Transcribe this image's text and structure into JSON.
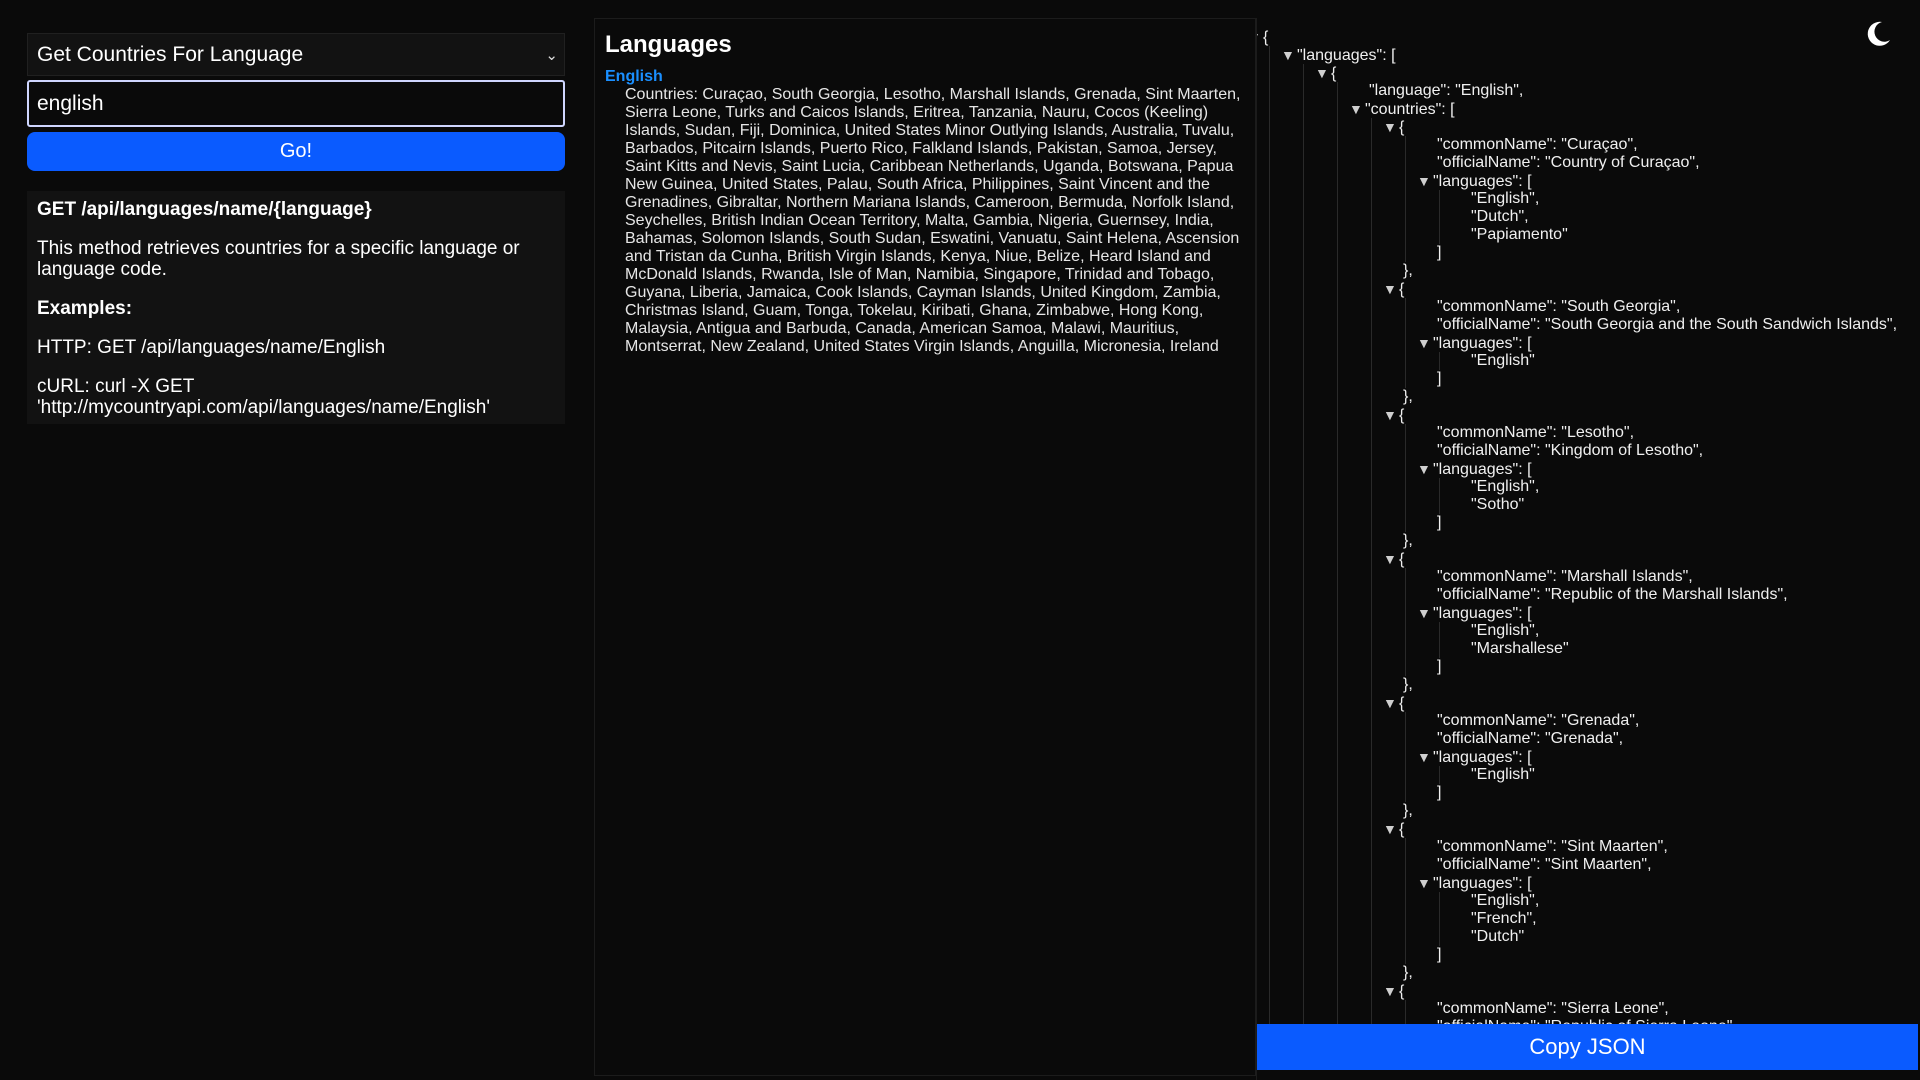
{
  "left": {
    "method_select": "Get Countries For Language",
    "input_value": "english",
    "go_label": "Go!",
    "doc": {
      "endpoint": "GET /api/languages/name/{language}",
      "description": "This method retrieves countries for a specific language or language code.",
      "examples_heading": "Examples:",
      "http_example": "HTTP: GET /api/languages/name/English",
      "curl_example": "cURL: curl -X GET 'http://mycountryapi.com/api/languages/name/English'"
    }
  },
  "middle": {
    "title": "Languages",
    "language": "English",
    "countries": "Countries: Curaçao, South Georgia, Lesotho, Marshall Islands, Grenada, Sint Maarten, Sierra Leone, Turks and Caicos Islands, Eritrea, Tanzania, Nauru, Cocos (Keeling) Islands, Sudan, Fiji, Dominica, United States Minor Outlying Islands, Australia, Tuvalu, Barbados, Pitcairn Islands, Puerto Rico, Falkland Islands, Pakistan, Samoa, Jersey, Saint Kitts and Nevis, Saint Lucia, Caribbean Netherlands, Uganda, Botswana, Papua New Guinea, United States, Palau, South Africa, Philippines, Saint Vincent and the Grenadines, Gibraltar, Northern Mariana Islands, Cameroon, Bermuda, Norfolk Island, Seychelles, British Indian Ocean Territory, Malta, Gambia, Nigeria, Guernsey, India, Bahamas, Solomon Islands, South Sudan, Eswatini, Vanuatu, Saint Helena, Ascension and Tristan da Cunha, British Virgin Islands, Kenya, Niue, Belize, Heard Island and McDonald Islands, Rwanda, Isle of Man, Namibia, Singapore, Trinidad and Tobago, Guyana, Liberia, Jamaica, Cook Islands, Cayman Islands, United Kingdom, Zambia, Christmas Island, Guam, Tonga, Tokelau, Kiribati, Ghana, Zimbabwe, Hong Kong, Malaysia, Antigua and Barbuda, Canada, American Samoa, Malawi, Mauritius, Montserrat, New Zealand, United States Virgin Islands, Anguilla, Micronesia, Ireland"
  },
  "right": {
    "copy_label": "Copy JSON",
    "theme_icon": "moon-icon",
    "json_lines": [
      {
        "indent": 0,
        "tri": true,
        "text": "{"
      },
      {
        "indent": 1,
        "tri": true,
        "text": "\"languages\": ["
      },
      {
        "indent": 2,
        "tri": true,
        "text": "{"
      },
      {
        "indent": 3,
        "tri": false,
        "text": "\"language\": \"English\","
      },
      {
        "indent": 3,
        "tri": true,
        "text": "\"countries\": ["
      },
      {
        "indent": 4,
        "tri": true,
        "text": "{"
      },
      {
        "indent": 5,
        "tri": false,
        "text": "\"commonName\": \"Curaçao\","
      },
      {
        "indent": 5,
        "tri": false,
        "text": "\"officialName\": \"Country of Curaçao\","
      },
      {
        "indent": 5,
        "tri": true,
        "text": "\"languages\": ["
      },
      {
        "indent": 6,
        "tri": false,
        "text": "\"English\","
      },
      {
        "indent": 6,
        "tri": false,
        "text": "\"Dutch\","
      },
      {
        "indent": 6,
        "tri": false,
        "text": "\"Papiamento\""
      },
      {
        "indent": 5,
        "tri": false,
        "text": "]"
      },
      {
        "indent": 4,
        "tri": false,
        "text": "},"
      },
      {
        "indent": 4,
        "tri": true,
        "text": "{"
      },
      {
        "indent": 5,
        "tri": false,
        "text": "\"commonName\": \"South Georgia\","
      },
      {
        "indent": 5,
        "tri": false,
        "text": "\"officialName\": \"South Georgia and the South Sandwich Islands\","
      },
      {
        "indent": 5,
        "tri": true,
        "text": "\"languages\": ["
      },
      {
        "indent": 6,
        "tri": false,
        "text": "\"English\""
      },
      {
        "indent": 5,
        "tri": false,
        "text": "]"
      },
      {
        "indent": 4,
        "tri": false,
        "text": "},"
      },
      {
        "indent": 4,
        "tri": true,
        "text": "{"
      },
      {
        "indent": 5,
        "tri": false,
        "text": "\"commonName\": \"Lesotho\","
      },
      {
        "indent": 5,
        "tri": false,
        "text": "\"officialName\": \"Kingdom of Lesotho\","
      },
      {
        "indent": 5,
        "tri": true,
        "text": "\"languages\": ["
      },
      {
        "indent": 6,
        "tri": false,
        "text": "\"English\","
      },
      {
        "indent": 6,
        "tri": false,
        "text": "\"Sotho\""
      },
      {
        "indent": 5,
        "tri": false,
        "text": "]"
      },
      {
        "indent": 4,
        "tri": false,
        "text": "},"
      },
      {
        "indent": 4,
        "tri": true,
        "text": "{"
      },
      {
        "indent": 5,
        "tri": false,
        "text": "\"commonName\": \"Marshall Islands\","
      },
      {
        "indent": 5,
        "tri": false,
        "text": "\"officialName\": \"Republic of the Marshall Islands\","
      },
      {
        "indent": 5,
        "tri": true,
        "text": "\"languages\": ["
      },
      {
        "indent": 6,
        "tri": false,
        "text": "\"English\","
      },
      {
        "indent": 6,
        "tri": false,
        "text": "\"Marshallese\""
      },
      {
        "indent": 5,
        "tri": false,
        "text": "]"
      },
      {
        "indent": 4,
        "tri": false,
        "text": "},"
      },
      {
        "indent": 4,
        "tri": true,
        "text": "{"
      },
      {
        "indent": 5,
        "tri": false,
        "text": "\"commonName\": \"Grenada\","
      },
      {
        "indent": 5,
        "tri": false,
        "text": "\"officialName\": \"Grenada\","
      },
      {
        "indent": 5,
        "tri": true,
        "text": "\"languages\": ["
      },
      {
        "indent": 6,
        "tri": false,
        "text": "\"English\""
      },
      {
        "indent": 5,
        "tri": false,
        "text": "]"
      },
      {
        "indent": 4,
        "tri": false,
        "text": "},"
      },
      {
        "indent": 4,
        "tri": true,
        "text": "{"
      },
      {
        "indent": 5,
        "tri": false,
        "text": "\"commonName\": \"Sint Maarten\","
      },
      {
        "indent": 5,
        "tri": false,
        "text": "\"officialName\": \"Sint Maarten\","
      },
      {
        "indent": 5,
        "tri": true,
        "text": "\"languages\": ["
      },
      {
        "indent": 6,
        "tri": false,
        "text": "\"English\","
      },
      {
        "indent": 6,
        "tri": false,
        "text": "\"French\","
      },
      {
        "indent": 6,
        "tri": false,
        "text": "\"Dutch\""
      },
      {
        "indent": 5,
        "tri": false,
        "text": "]"
      },
      {
        "indent": 4,
        "tri": false,
        "text": "},"
      },
      {
        "indent": 4,
        "tri": true,
        "text": "{"
      },
      {
        "indent": 5,
        "tri": false,
        "text": "\"commonName\": \"Sierra Leone\","
      },
      {
        "indent": 5,
        "tri": false,
        "text": "\"officialName\": \"Republic of Sierra Leone\","
      }
    ]
  }
}
